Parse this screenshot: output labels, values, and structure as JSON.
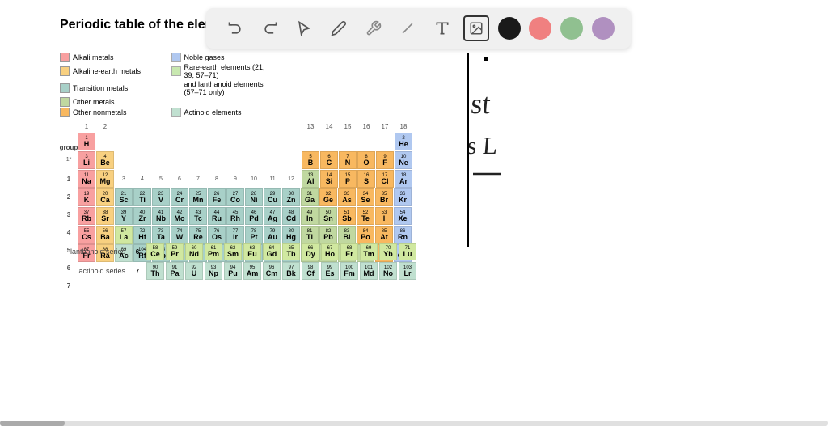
{
  "title": "Periodic table of the element",
  "toolbar": {
    "tools": [
      "undo",
      "redo",
      "select",
      "pencil",
      "tools",
      "line",
      "text",
      "image"
    ],
    "colors": [
      "black",
      "pink",
      "green",
      "purple"
    ],
    "color_values": [
      "#1a1a1a",
      "#f08080",
      "#90c090",
      "#b090c0"
    ]
  },
  "legend": {
    "items": [
      {
        "label": "Alkali metals",
        "color": "#f8a0a0"
      },
      {
        "label": "Noble gases",
        "color": "#b0c8f0"
      },
      {
        "label": "Alkaline-earth metals",
        "color": "#f8d080"
      },
      {
        "label": "Rare-earth elements (21, 39, 57–71)",
        "color": "#c8e8b0"
      },
      {
        "label": "Transition metals",
        "color": "#a8d0c8"
      },
      {
        "label": "and lanthanoid elements (57–71 only)",
        "color": "#c8e8b0"
      },
      {
        "label": "Other metals",
        "color": "#c0d8a0"
      },
      {
        "label": "",
        "color": ""
      },
      {
        "label": "Other nonmetals",
        "color": "#f8b860"
      },
      {
        "label": "Actinoid elements",
        "color": "#c0e0d0"
      }
    ]
  },
  "periods": [
    "1",
    "2",
    "3",
    "4",
    "5",
    "6",
    "7"
  ],
  "groups": [
    "1",
    "2",
    "3",
    "4",
    "5",
    "6",
    "7",
    "8",
    "9",
    "10",
    "11",
    "12",
    "13",
    "14",
    "15",
    "16",
    "17",
    "18"
  ],
  "elements": {
    "H": {
      "num": 1,
      "sym": "H",
      "period": 1,
      "group": 1,
      "type": "alkali"
    },
    "He": {
      "num": 2,
      "sym": "He",
      "period": 1,
      "group": 18,
      "type": "noble"
    },
    "Li": {
      "num": 3,
      "sym": "Li",
      "period": 2,
      "group": 1,
      "type": "alkali"
    },
    "Be": {
      "num": 4,
      "sym": "Be",
      "period": 2,
      "group": 2,
      "type": "alkaline"
    }
  },
  "bottom": {
    "lanthanoid_label": "lanthanoid series",
    "actinoid_label": "actinoid series"
  }
}
